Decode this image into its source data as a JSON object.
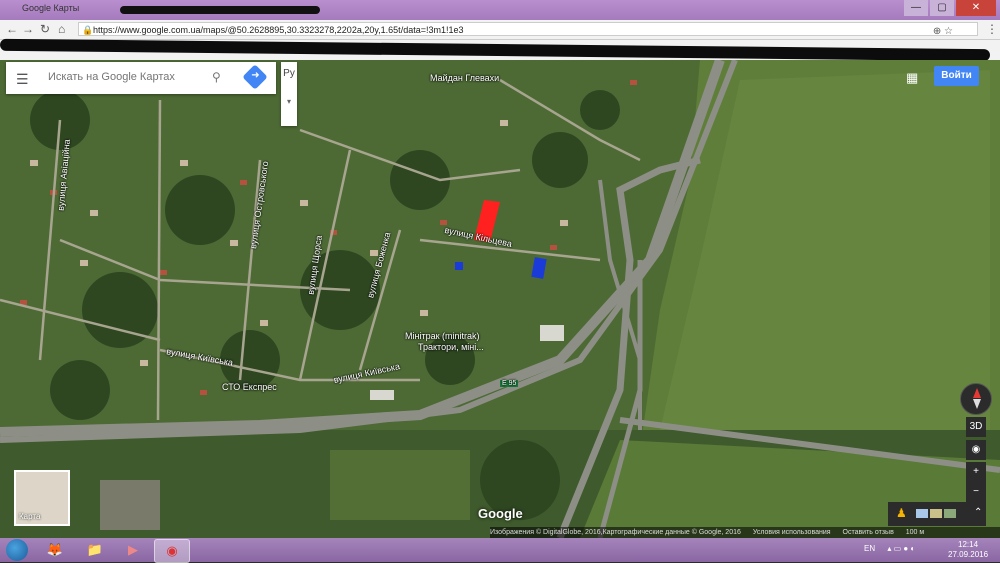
{
  "browser": {
    "tab_title": "Google Карты",
    "url": "https://www.google.com.ua/maps/@50.2628895,30.3323278,2202a,20y,1.65t/data=!3m1!1e3",
    "nav": {
      "back": "←",
      "forward": "→",
      "reload": "↻",
      "home": "⌂"
    },
    "url_icons": "⊕ ☆",
    "menu": "⋮",
    "window_buttons": {
      "minimize": "—",
      "maximize": "▢",
      "close": "✕"
    }
  },
  "map": {
    "search_placeholder": "Искать на Google Картах",
    "lang_label": "Ру",
    "lang_toggle": "▾",
    "apps_icon": "⋮⋮⋮",
    "signin_label": "Войти",
    "labels": {
      "maidan": "Майдан Глевахи",
      "koltseva": "вулиця Кільцева",
      "kyivska1": "вулиця Київська",
      "kyivska2": "вулиця Київська",
      "minitrak1": "Мінітрак (minitrak)",
      "minitrak2": "Трактори, міні...",
      "sto": "СТО Експрес",
      "shorsa": "вулиця Щорса",
      "bozhenka": "вулиця Боженка",
      "ostrovskoho": "вулиця Островського",
      "avianosna": "вулиця Авіаційна",
      "road": "E 95"
    },
    "controls": {
      "tilt": "3D",
      "locate": "◉",
      "zoom_in": "+",
      "zoom_out": "−",
      "expand": "⌃"
    },
    "minimap_label": "Карта",
    "logo": "Google",
    "footer": {
      "imagery": "Изображения © DigitalGlobe, 2016,Картографические данные © Google, 2016",
      "terms": "Условия использования",
      "feedback": "Оставить отзыв",
      "scale": "100 м"
    }
  },
  "taskbar": {
    "apps": [
      {
        "name": "firefox",
        "glyph": "🦊"
      },
      {
        "name": "explorer",
        "glyph": "📁"
      },
      {
        "name": "media-player",
        "glyph": "▶"
      },
      {
        "name": "chrome",
        "glyph": "◉"
      }
    ],
    "lang": "EN",
    "tray_icons": "▴ ▭ ● ◐",
    "time": "12:14",
    "date": "27.09.2016"
  }
}
